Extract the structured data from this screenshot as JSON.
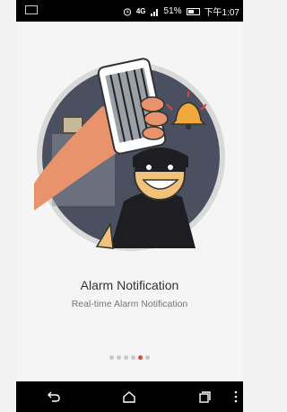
{
  "status_bar": {
    "network": "4G",
    "battery": "51%",
    "time": "下午1:07"
  },
  "onboarding": {
    "title": "Alarm Notification",
    "subtitle": "Real-time Alarm Notification",
    "pager": {
      "total": 6,
      "active_index": 4
    }
  },
  "icons": {
    "notification": "notification-icon",
    "alarm": "alarm-clock-icon",
    "signal": "signal-icon",
    "battery": "battery-icon",
    "back": "back-icon",
    "home": "home-icon",
    "recents": "recents-icon",
    "more": "more-icon",
    "bell": "bell-icon"
  },
  "colors": {
    "accent": "#e0473f",
    "circle": "#4a5060",
    "bell": "#f2a93b"
  }
}
